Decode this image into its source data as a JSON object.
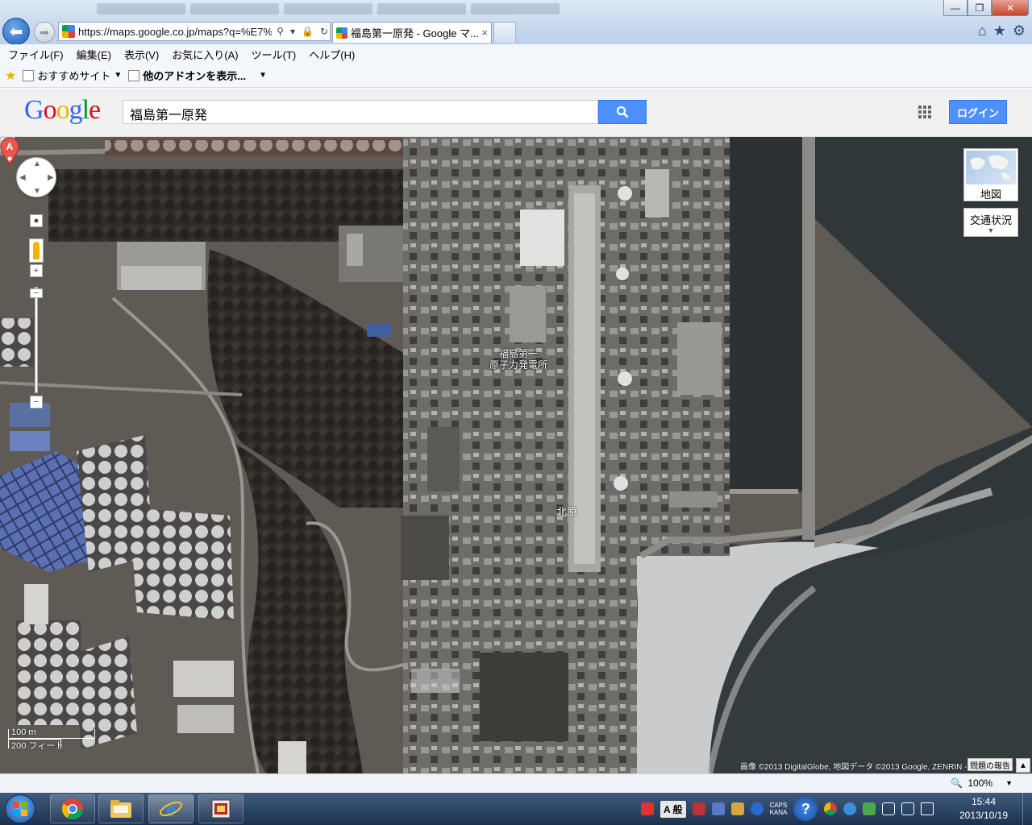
{
  "window": {
    "minimize": "—",
    "maximize": "❐",
    "close": "✕"
  },
  "addressbar": {
    "url": "https://maps.google.co.jp/maps?q=%E7%",
    "search_glyph": "⚲",
    "lock_glyph": "🔒",
    "refresh_glyph": "↻"
  },
  "tabs": [
    {
      "title": "福島第一原発 - Google マ...",
      "close": "×"
    }
  ],
  "menu": [
    "ファイル(F)",
    "編集(E)",
    "表示(V)",
    "お気に入り(A)",
    "ツール(T)",
    "ヘルプ(H)"
  ],
  "favorites": {
    "item1": "おすすめサイト",
    "item2": "他のアドオンを表示...",
    "dropdown": "▼"
  },
  "google": {
    "logo": [
      "G",
      "o",
      "o",
      "g",
      "l",
      "e"
    ],
    "logo_colors": [
      "#3369e8",
      "#d50f25",
      "#eeb211",
      "#3369e8",
      "#009925",
      "#d50f25"
    ],
    "query": "福島第一原発",
    "login": "ログイン"
  },
  "map": {
    "map_type_label": "地図",
    "traffic_label": "交通状況",
    "marker_letter": "A",
    "marker_label_l1": "福島第一",
    "marker_label_l2": "原子力発電所",
    "place_label": "北原",
    "scale_top": "100 m",
    "scale_bottom": "200 フィート",
    "attribution": "画像 ©2013 DigitalGlobe, 地図データ ©2013 Google, ZENRIN -",
    "report": "問題の報告",
    "pan": {
      "up": "▲",
      "down": "▼",
      "left": "◀",
      "right": "▶"
    },
    "zoom_in": "+",
    "zoom_out": "−",
    "colors": {
      "sea": "#30373a",
      "land": "#5f5b54",
      "pin": "#e8574b"
    }
  },
  "statusbar": {
    "zoom": "100%",
    "zoom_dropdown": "▼"
  },
  "taskbar": {
    "ime_mode": "A 般",
    "caps": "CAPS",
    "kana": "KANA",
    "help": "?",
    "time": "15:44",
    "date": "2013/10/19"
  }
}
